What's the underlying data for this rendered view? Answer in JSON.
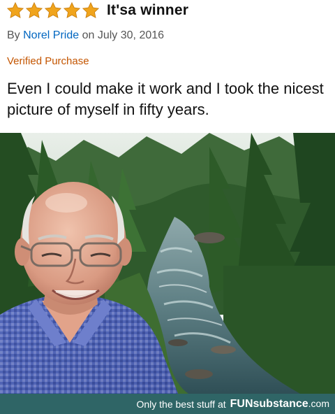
{
  "review": {
    "stars": 5,
    "star_color": "#f0a41c",
    "title": "It'sa winner",
    "by_prefix": "By",
    "author": "Norel Pride",
    "date_text": "on July 30, 2016",
    "verified": "Verified Purchase",
    "body": "Even I could make it work and I took the nicest picture of myself in fifty years."
  },
  "photo": {
    "subject": "selfie-river-forest"
  },
  "footer": {
    "tagline": "Only the best stuff at",
    "brand": "FUNsubstance",
    "domain": ".com"
  }
}
